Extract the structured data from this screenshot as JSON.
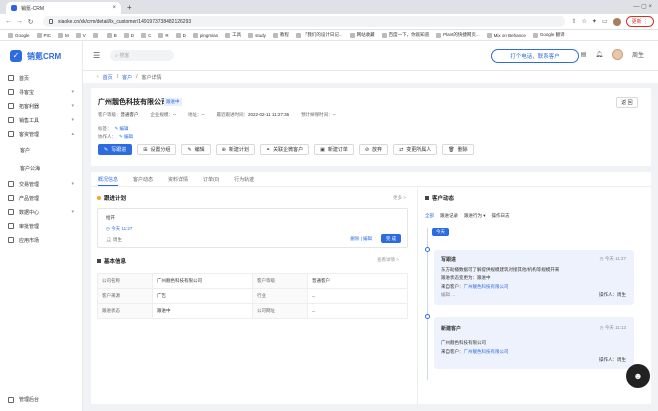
{
  "browser": {
    "tab_title": "销氪-CRM",
    "new_tab": "+",
    "url": "xiaoke.cn/xk/crm/detail/lx_customer/1491973738482126293",
    "update_label": "更新 ⋮",
    "bookmarks": [
      "Google",
      "PIC",
      "M",
      "V",
      "",
      "B",
      "D",
      "C",
      "R",
      "D",
      "pingmian",
      "工具",
      "study",
      "教程",
      "「我们的设计日记...",
      "网站收藏",
      "百度一下，你就知道",
      "Plant的快捷网页...",
      "Mix on Behance",
      "Google 翻译"
    ]
  },
  "app": {
    "logo_text": "销氪CRM",
    "search_placeholder": "搜客",
    "call_button": "打个电话，联系客户",
    "user_name": "周生",
    "sidebar": {
      "items": [
        {
          "label": "首页"
        },
        {
          "label": "寻客宝",
          "chev": "▾"
        },
        {
          "label": "拓客利器",
          "chev": "▾"
        },
        {
          "label": "销售工具",
          "chev": "▾"
        },
        {
          "label": "客资管理",
          "chev": "▴"
        }
      ],
      "sub_items": [
        "客户",
        "客户公海"
      ],
      "items2": [
        {
          "label": "交易管理",
          "chev": "▾"
        },
        {
          "label": "产品管理"
        },
        {
          "label": "数据中心",
          "chev": "▾"
        },
        {
          "label": "审批管理"
        },
        {
          "label": "应用市场"
        }
      ],
      "bottom": "管理后台"
    },
    "breadcrumb": [
      "首页",
      "/",
      "客户",
      "/",
      "客户详情"
    ]
  },
  "customer": {
    "name": "广州靓色科技有限公司",
    "tag": "跟进中",
    "return_label": "返 回",
    "meta": [
      {
        "k": "客户等级：",
        "v": "普通客户"
      },
      {
        "k": "企业规模：",
        "v": "--"
      },
      {
        "k": "地址：",
        "v": "--"
      },
      {
        "k": "最近跟进时间：",
        "v": "2022-02-11 11:27:36"
      },
      {
        "k": "预计掉保时间：",
        "v": "--"
      }
    ],
    "tag_label": "标签：",
    "tag_edit": "编辑",
    "helper_label": "协作人：",
    "helper_edit": "编辑",
    "actions": [
      "写跟进",
      "设置分组",
      "编辑",
      "新建计划",
      "关联企微客户",
      "新建订单",
      "放弃",
      "变更所属人",
      "删除"
    ]
  },
  "tabs": [
    "概况信息",
    "客户动态",
    "资料详情",
    "订单(0)",
    "行为轨迹"
  ],
  "plan": {
    "title": "跟进计划",
    "more": "更多 >",
    "item_title": "给开",
    "item_time": "今天 11:27",
    "item_user": "周生",
    "edit": "删除 | 编辑",
    "done": "完 成"
  },
  "basic": {
    "title": "基本信息",
    "more": "查看详情 >",
    "rows": [
      [
        "公司名称",
        "广州靓色科技有限公司",
        "客户等级",
        "普通客户"
      ],
      [
        "客户来源",
        "广告",
        "行业",
        "--"
      ],
      [
        "跟进状态",
        "跟进中",
        "公司网址",
        "--"
      ]
    ]
  },
  "dynamics": {
    "title": "客户动态",
    "filters": [
      "全部",
      "跟进记录",
      "跟进行为 ▾",
      "操作日志"
    ],
    "badge": "今天",
    "card1": {
      "title": "写跟进",
      "time": "今天 11:27",
      "line1": "东方助播数据可了解提供规模建筑对接其他/机构等规模开来",
      "line2": "跟进状态变更为：跟进中",
      "from_label": "来自客户：",
      "from": "广州靓色科技有限公司",
      "extra": "编辑 ...",
      "op": "操作人：周生"
    },
    "card2": {
      "title": "新建客户",
      "time": "今天 11:13",
      "line1": "广州靓色科技有限公司",
      "from_label": "来自客户：",
      "from": "广州靓色科技有限公司",
      "op": "操作人：周生"
    }
  }
}
